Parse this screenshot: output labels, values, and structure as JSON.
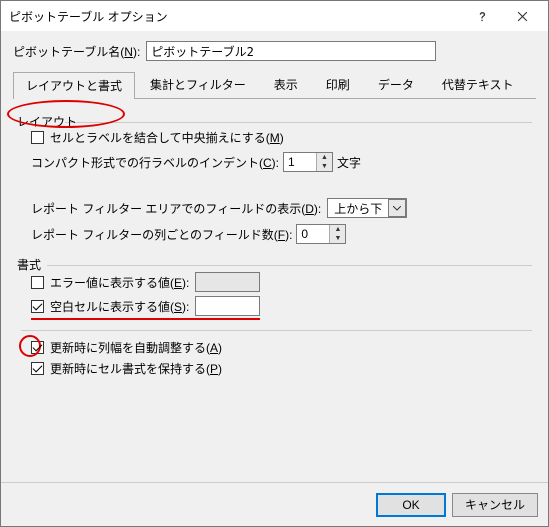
{
  "window": {
    "title": "ピボットテーブル オプション"
  },
  "name_field": {
    "label_pre": "ピボットテーブル名(",
    "key": "N",
    "label_post": "):",
    "value": "ピボットテーブル2"
  },
  "tabs": {
    "t0": "レイアウトと書式",
    "t1": "集計とフィルター",
    "t2": "表示",
    "t3": "印刷",
    "t4": "データ",
    "t5": "代替テキスト"
  },
  "groups": {
    "layout": "レイアウト",
    "format": "書式"
  },
  "layout": {
    "merge": {
      "pre": "セルとラベルを結合して中央揃えにする(",
      "key": "M",
      "post": ")",
      "checked": false
    },
    "indent": {
      "pre": "コンパクト形式での行ラベルのインデント(",
      "key": "C",
      "post": "):",
      "value": "1",
      "unit": "文字"
    },
    "filter_disp": {
      "pre": "レポート フィルター エリアでのフィールドの表示(",
      "key": "D",
      "post": "):",
      "value": "上から下"
    },
    "filter_cols": {
      "pre": "レポート フィルターの列ごとのフィールド数(",
      "key": "F",
      "post": "):",
      "value": "0"
    }
  },
  "format": {
    "err": {
      "pre": "エラー値に表示する値(",
      "key": "E",
      "post": "):",
      "checked": false
    },
    "blank": {
      "pre": "空白セルに表示する値(",
      "key": "S",
      "post": "):",
      "checked": true
    },
    "autofit": {
      "pre": "更新時に列幅を自動調整する(",
      "key": "A",
      "post": ")",
      "checked": true
    },
    "preserve": {
      "pre": "更新時にセル書式を保持する(",
      "key": "P",
      "post": ")",
      "checked": true
    }
  },
  "buttons": {
    "ok": "OK",
    "cancel": "キャンセル"
  }
}
